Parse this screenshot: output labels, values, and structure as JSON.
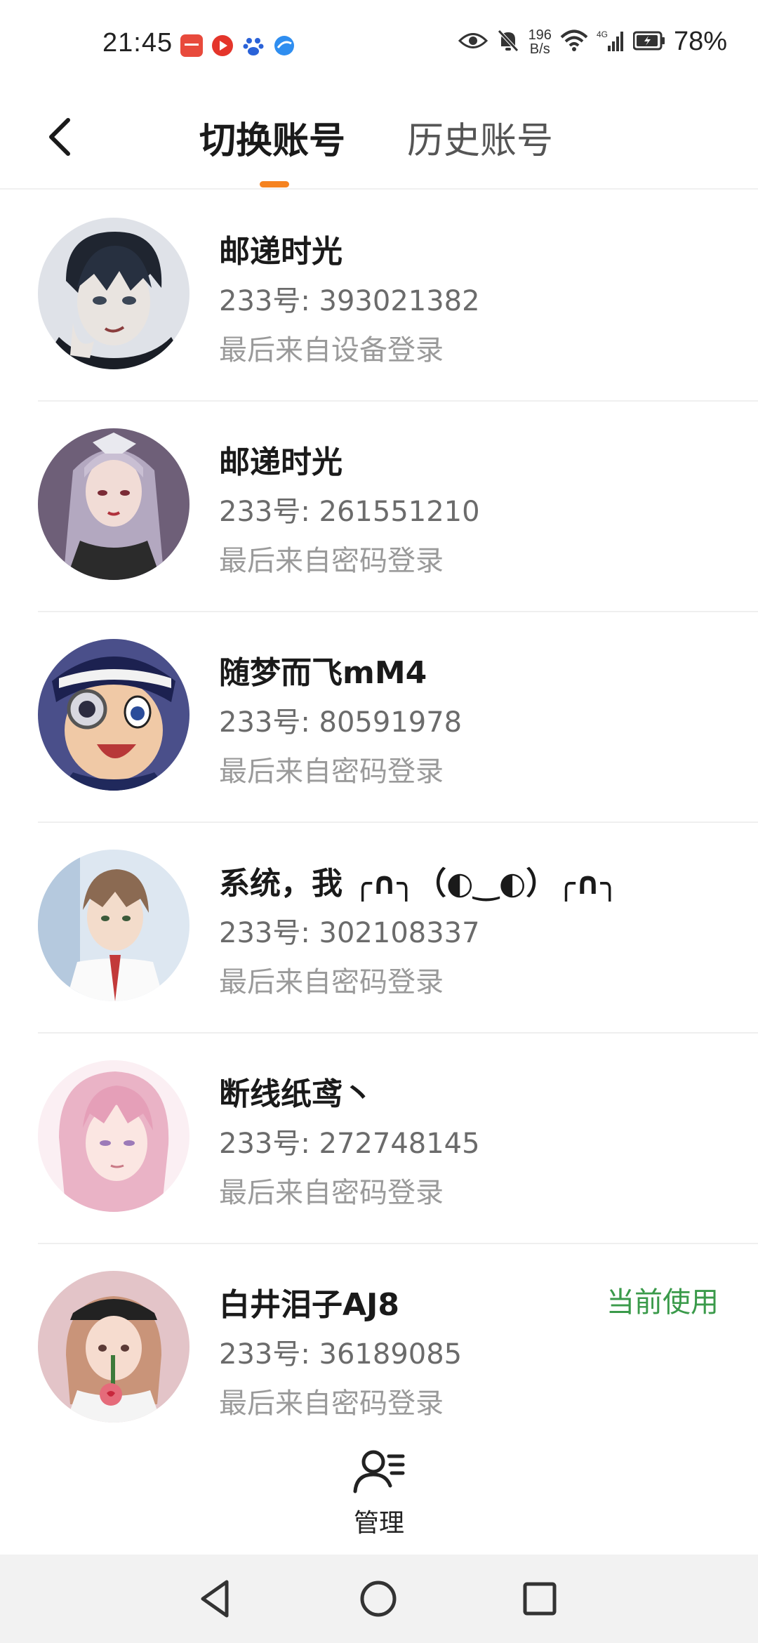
{
  "status": {
    "time": "21:45",
    "net_speed_value": "196",
    "net_speed_unit": "B/s",
    "network_type": "4G",
    "battery": "78%"
  },
  "header": {
    "tabs": [
      {
        "label": "切换账号",
        "active": true
      },
      {
        "label": "历史账号",
        "active": false
      }
    ]
  },
  "accounts": [
    {
      "name": "邮递时光",
      "id": "233号: 393021382",
      "login": "最后来自设备登录",
      "current": "",
      "avatar_color": "#3b4656"
    },
    {
      "name": "邮递时光",
      "id": "233号: 261551210",
      "login": "最后来自密码登录",
      "current": "",
      "avatar_color": "#6e5f78"
    },
    {
      "name": "随梦而飞mM4",
      "id": "233号: 80591978",
      "login": "最后来自密码登录",
      "current": "",
      "avatar_color": "#2e3a6e"
    },
    {
      "name": "系统，我 ╭∩╮（◐‿◐）╭∩╮",
      "id": "233号: 302108337",
      "login": "最后来自密码登录",
      "current": "",
      "avatar_color": "#9ab3cf"
    },
    {
      "name": "断线纸鸢丶",
      "id": "233号: 272748145",
      "login": "最后来自密码登录",
      "current": "",
      "avatar_color": "#e9b7c8"
    },
    {
      "name": "白井泪子AJ8",
      "id": "233号: 36189085",
      "login": "最后来自密码登录",
      "current": "当前使用",
      "avatar_color": "#d9a7a5"
    }
  ],
  "footer": {
    "manage_label": "管理"
  },
  "colors": {
    "accent": "#f5821f",
    "current_green": "#3a9a4a"
  },
  "icons": [
    "back-arrow-icon",
    "manage-user-icon",
    "nav-back-icon",
    "nav-home-icon",
    "nav-recents-icon"
  ]
}
